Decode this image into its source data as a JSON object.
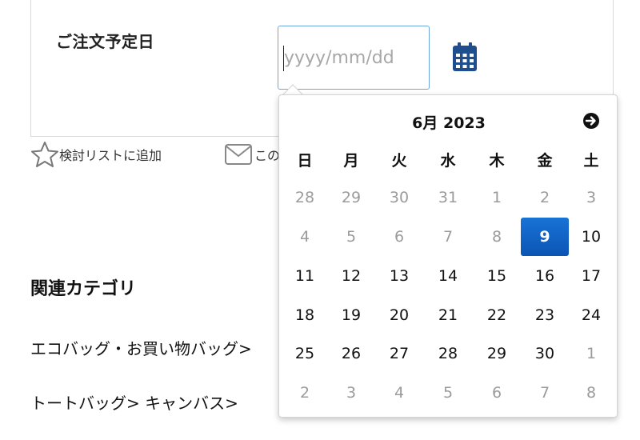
{
  "order": {
    "label": "ご注文予定日",
    "date_placeholder": "yyyy/mm/dd",
    "calendar_icon": "calendar-icon"
  },
  "actions": {
    "wishlist_label": "検討リストに追加",
    "wishlist_icon": "star-icon",
    "mail_label": "この",
    "mail_icon": "mail-icon"
  },
  "related": {
    "title": "関連カテゴリ",
    "links": [
      "エコバッグ・お買い物バッグ>",
      "トートバッグ> キャンバス>"
    ]
  },
  "calendar": {
    "month_label": "6月 2023",
    "next_icon": "arrow-right-circle-icon",
    "weekdays": [
      "日",
      "月",
      "火",
      "水",
      "木",
      "金",
      "土"
    ],
    "weeks": [
      [
        {
          "d": "28",
          "m": true
        },
        {
          "d": "29",
          "m": true
        },
        {
          "d": "30",
          "m": true
        },
        {
          "d": "31",
          "m": true
        },
        {
          "d": "1",
          "m": true
        },
        {
          "d": "2",
          "m": true
        },
        {
          "d": "3",
          "m": true
        }
      ],
      [
        {
          "d": "4",
          "m": true
        },
        {
          "d": "5",
          "m": true
        },
        {
          "d": "6",
          "m": true
        },
        {
          "d": "7",
          "m": true
        },
        {
          "d": "8",
          "m": true
        },
        {
          "d": "9",
          "s": true
        },
        {
          "d": "10"
        }
      ],
      [
        {
          "d": "11"
        },
        {
          "d": "12"
        },
        {
          "d": "13"
        },
        {
          "d": "14"
        },
        {
          "d": "15"
        },
        {
          "d": "16"
        },
        {
          "d": "17"
        }
      ],
      [
        {
          "d": "18"
        },
        {
          "d": "19"
        },
        {
          "d": "20"
        },
        {
          "d": "21"
        },
        {
          "d": "22"
        },
        {
          "d": "23"
        },
        {
          "d": "24"
        }
      ],
      [
        {
          "d": "25"
        },
        {
          "d": "26"
        },
        {
          "d": "27"
        },
        {
          "d": "28"
        },
        {
          "d": "29"
        },
        {
          "d": "30"
        },
        {
          "d": "1",
          "m": true
        }
      ],
      [
        {
          "d": "2",
          "m": true
        },
        {
          "d": "3",
          "m": true
        },
        {
          "d": "4",
          "m": true
        },
        {
          "d": "5",
          "m": true
        },
        {
          "d": "6",
          "m": true
        },
        {
          "d": "7",
          "m": true
        },
        {
          "d": "8",
          "m": true
        }
      ]
    ],
    "selected_color": "#0d5fc0"
  }
}
